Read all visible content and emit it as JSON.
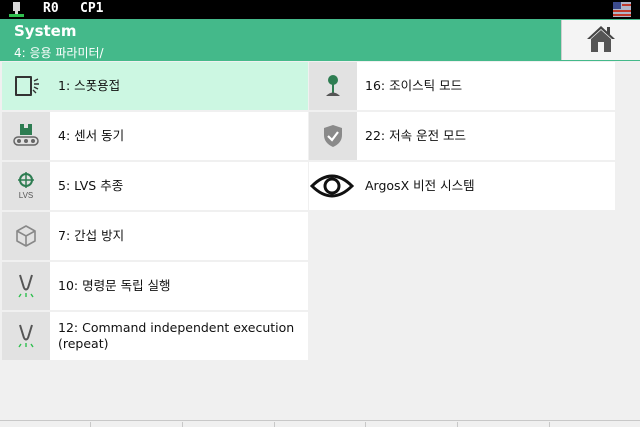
{
  "status": {
    "robot": "R0",
    "cp": "CP1"
  },
  "header": {
    "title": "System",
    "path": "4: 응용 파라미터/"
  },
  "menu": {
    "spot_weld": "1: 스폿용접",
    "sensor_sync": "4: 센서 동기",
    "lvs_tracking": "5: LVS 추종",
    "lvs_icon_text": "LVS",
    "interference": "7: 간섭 방지",
    "command_exec": "10: 명령문 독립 실행",
    "command_repeat": "12: Command independent execution (repeat)",
    "joystick": "16: 조이스틱 모드",
    "low_speed": "22: 저속 운전 모드",
    "argosx": "ArgosX 비전 시스템"
  },
  "colors": {
    "accent": "#44b98a",
    "selected": "#ccf7e2"
  }
}
